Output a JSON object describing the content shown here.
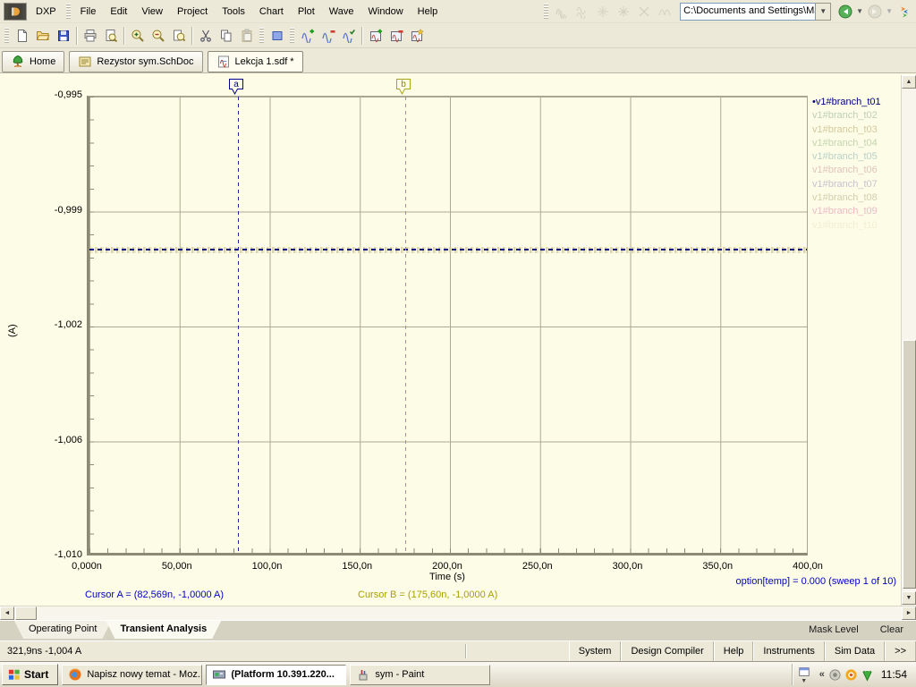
{
  "window": {
    "address": "C:\\Documents and Settings\\Marcin\\Pul"
  },
  "menu": {
    "app": "DXP",
    "items": [
      "File",
      "Edit",
      "View",
      "Project",
      "Tools",
      "Chart",
      "Plot",
      "Wave",
      "Window",
      "Help"
    ],
    "disabled_tools": [
      "overlay-waves-icon",
      "stack-waves-icon",
      "measure-wave-icon",
      "node-wave-icon",
      "cross-probe-icon",
      "split-wave-icon"
    ]
  },
  "toolbar": {
    "groups": [
      [
        "new-document-icon",
        "open-folder-icon",
        "save-icon"
      ],
      [
        "print-icon",
        "print-preview-icon"
      ],
      [
        "zoom-in-icon",
        "zoom-out-icon",
        "zoom-document-icon"
      ],
      [
        "cut-icon",
        "copy-icon",
        "paste-icon"
      ],
      [
        "panels-icon"
      ],
      [
        "add-wave-icon",
        "remove-wave-icon",
        "check-wave-icon"
      ],
      [
        "add-chart-icon",
        "remove-chart-icon",
        "new-chart-icon"
      ]
    ],
    "disabled": [
      "paste-icon"
    ]
  },
  "doc_tabs": [
    {
      "label": "Home",
      "icon": "home-icon",
      "active": false
    },
    {
      "label": "Rezystor sym.SchDoc",
      "icon": "schdoc-icon",
      "active": false
    },
    {
      "label": "Lekcja 1.sdf *",
      "icon": "sdf-icon",
      "active": true
    }
  ],
  "chart_data": {
    "type": "line",
    "title": "Transient Analysis",
    "xlabel": "Time (s)",
    "ylabel": "(A)",
    "x_ticks": [
      "0,000n",
      "50,00n",
      "100,0n",
      "150,0n",
      "200,0n",
      "250,0n",
      "300,0n",
      "350,0n",
      "400,0n"
    ],
    "y_ticks": [
      "-0,995",
      "-0,999",
      "-1,002",
      "-1,006",
      "-1,010"
    ],
    "x_range_seconds": [
      0,
      4e-07
    ],
    "y_range_amps": [
      -1.01,
      -0.995
    ],
    "grid": true,
    "legend_position": "right",
    "series": [
      {
        "name": "v1#branch_t01",
        "color": "#000080",
        "constant_value_A": -1.0,
        "active": true
      },
      {
        "name": "v1#branch_t02",
        "color": "#bdd0b6",
        "constant_value_A": -1.0,
        "active": false
      },
      {
        "name": "v1#branch_t03",
        "color": "#d3c99e",
        "constant_value_A": -1.0,
        "active": false
      },
      {
        "name": "v1#branch_t04",
        "color": "#c3d5ae",
        "constant_value_A": -1.0,
        "active": false
      },
      {
        "name": "v1#branch_t05",
        "color": "#bad0c8",
        "constant_value_A": -1.0,
        "active": false
      },
      {
        "name": "v1#branch_t06",
        "color": "#e0c4be",
        "constant_value_A": -1.0,
        "active": false
      },
      {
        "name": "v1#branch_t07",
        "color": "#c7c1d3",
        "constant_value_A": -1.0,
        "active": false
      },
      {
        "name": "v1#branch_t08",
        "color": "#d1d0ae",
        "constant_value_A": -1.0,
        "active": false
      },
      {
        "name": "v1#branch_t09",
        "color": "#eebac8",
        "constant_value_A": -1.0,
        "active": false
      },
      {
        "name": "v1#branch_t10",
        "color": "#f1eed2",
        "constant_value_A": -1.0,
        "active": false
      }
    ],
    "cursors": [
      {
        "label": "a",
        "x": "82,569n",
        "y": "-1,0000 A",
        "color": "#0000C8"
      },
      {
        "label": "b",
        "x": "175,60n",
        "y": "-1,0000 A",
        "color": "#A8A000"
      }
    ],
    "annotation": "option[temp] = 0.000  (sweep 1 of 10)"
  },
  "readouts": {
    "cursor_a": "Cursor A = (82,569n, -1,0000 A)",
    "cursor_b": "Cursor B = (175,60n, -1,0000 A)"
  },
  "sheet_tabs": [
    {
      "label": "Operating Point",
      "active": false
    },
    {
      "label": "Transient Analysis",
      "active": true
    }
  ],
  "mask_level_label": "Mask Level",
  "clear_label": "Clear",
  "status": {
    "left": "321,9ns -1,004 A",
    "panels": [
      "System",
      "Design Compiler",
      "Help",
      "Instruments",
      "Sim Data",
      ">>"
    ]
  },
  "taskbar": {
    "start_label": "Start",
    "tasks": [
      {
        "label": "Napisz nowy temat - Moz...",
        "icon": "firefox-icon",
        "active": false
      },
      {
        "label": "(Platform 10.391.220...",
        "icon": "platform-icon",
        "active": true
      },
      {
        "label": "sym - Paint",
        "icon": "paint-icon",
        "active": false
      }
    ],
    "tray_icons": [
      "speaker-icon",
      "update-icon",
      "network-icon"
    ],
    "clock": "11:54"
  }
}
